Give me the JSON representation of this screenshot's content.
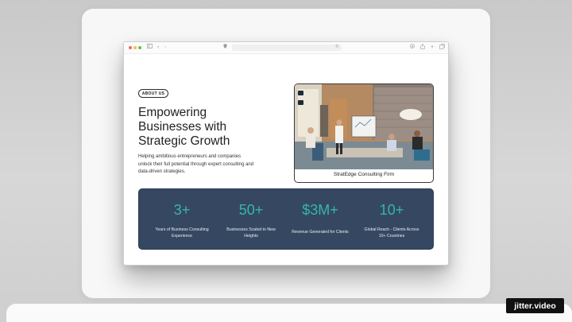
{
  "hero": {
    "badge": "ABOUT US",
    "headline_lines": [
      "Empowering",
      "Businesses with",
      "Strategic Growth"
    ],
    "description_lines": [
      "Helping ambitious entrepreneurs and companies",
      "unlock their full potential through expert consulting and",
      "data-driven strategies."
    ]
  },
  "photo_card": {
    "caption": "StratEdge Consulting Firm"
  },
  "stats": [
    {
      "value": "3+",
      "label_lines": [
        "Years of Business Consulting",
        "Experience"
      ]
    },
    {
      "value": "50+",
      "label_lines": [
        "Businesses Scaled to New",
        "Heights"
      ]
    },
    {
      "value": "$3M+",
      "label_lines": [
        "Revenue Generated for Clients"
      ]
    },
    {
      "value": "10+",
      "label_lines": [
        "Global Reach - Clients Across",
        "10+ Countries"
      ]
    }
  ],
  "watermark": "jitter.video",
  "colors": {
    "accent": "#36b5aa",
    "stats_bg": "#364861",
    "traffic_red": "#f06b5f",
    "traffic_yellow": "#f4bf4f",
    "traffic_green": "#5fc253"
  },
  "icons": {
    "sidebar": "sidebar-icon",
    "back": "chevron-left-icon",
    "forward": "chevron-right-icon",
    "shield": "shield-icon",
    "reload": "reload-icon",
    "download": "download-icon",
    "share": "share-icon",
    "new_tab": "plus-icon",
    "tabs": "tabs-icon"
  }
}
